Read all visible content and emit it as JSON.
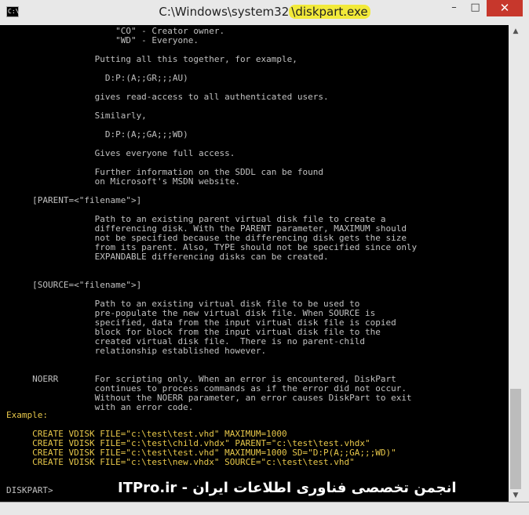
{
  "window": {
    "title_prefix": "C:\\Windows\\system32",
    "title_highlight": "\\diskpart.exe",
    "icon_label": "C:\\"
  },
  "controls": {
    "minimize": "–",
    "maximize": "□",
    "close": "✕"
  },
  "console": {
    "body": "                     \"CO\" - Creator owner.\n                     \"WD\" - Everyone.\n\n                 Putting all this together, for example,\n\n                   D:P:(A;;GR;;;AU)\n\n                 gives read-access to all authenticated users.\n\n                 Similarly,\n\n                   D:P:(A;;GA;;;WD)\n\n                 Gives everyone full access.\n\n                 Further information on the SDDL can be found\n                 on Microsoft's MSDN website.\n\n     [PARENT=<\"filename\">]\n\n                 Path to an existing parent virtual disk file to create a\n                 differencing disk. With the PARENT parameter, MAXIMUM should\n                 not be specified because the differencing disk gets the size\n                 from its parent. Also, TYPE should not be specified since only\n                 EXPANDABLE differencing disks can be created.\n\n\n     [SOURCE=<\"filename\">]\n\n                 Path to an existing virtual disk file to be used to\n                 pre-populate the new virtual disk file. When SOURCE is\n                 specified, data from the input virtual disk file is copied\n                 block for block from the input virtual disk file to the\n                 created virtual disk file.  There is no parent-child\n                 relationship established however.\n\n\n     NOERR       For scripting only. When an error is encountered, DiskPart\n                 continues to process commands as if the error did not occur.\n                 Without the NOERR parameter, an error causes DiskPart to exit\n                 with an error code.",
    "example_label": "Example:",
    "examples": "\n\n     CREATE VDISK FILE=\"c:\\test\\test.vhd\" MAXIMUM=1000\n     CREATE VDISK FILE=\"c:\\test\\child.vhdx\" PARENT=\"c:\\test\\test.vhdx\"\n     CREATE VDISK FILE=\"c:\\test\\test.vhd\" MAXIMUM=1000 SD=\"D:P(A;;GA;;;WD)\"\n     CREATE VDISK FILE=\"c:\\test\\new.vhdx\" SOURCE=\"c:\\test\\test.vhd\"",
    "prompt": "DISKPART>"
  },
  "watermark": "ITPro.ir - انجمن تخصصی فناوری اطلاعات ایران"
}
